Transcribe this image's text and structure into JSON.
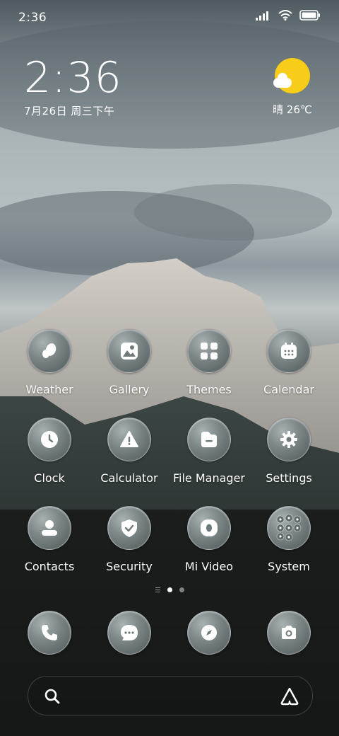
{
  "status_bar": {
    "time": "2:36"
  },
  "lock_widget": {
    "time": "2:36",
    "date": "7月26日 周三下午"
  },
  "weather_widget": {
    "text": "晴 26℃",
    "icon": "sun-cloud-icon"
  },
  "apps": [
    {
      "label": "Weather",
      "icon": "weather-icon"
    },
    {
      "label": "Gallery",
      "icon": "gallery-icon"
    },
    {
      "label": "Themes",
      "icon": "themes-icon"
    },
    {
      "label": "Calendar",
      "icon": "calendar-icon"
    },
    {
      "label": "Clock",
      "icon": "clock-icon"
    },
    {
      "label": "Calculator",
      "icon": "calculator-icon"
    },
    {
      "label": "File Manager",
      "icon": "folder-icon"
    },
    {
      "label": "Settings",
      "icon": "gear-icon"
    },
    {
      "label": "Contacts",
      "icon": "contact-icon"
    },
    {
      "label": "Security",
      "icon": "shield-icon"
    },
    {
      "label": "Mi Video",
      "icon": "video-icon"
    },
    {
      "label": "System",
      "icon": "folder-grid-icon"
    }
  ],
  "dock": [
    {
      "icon": "phone-icon"
    },
    {
      "icon": "message-icon"
    },
    {
      "icon": "compass-icon"
    },
    {
      "icon": "camera-icon"
    }
  ],
  "page_indicator": {
    "pages": 2,
    "active": 0
  },
  "search": {
    "icon": "search-icon",
    "assistant_icon": "assistant-icon"
  }
}
